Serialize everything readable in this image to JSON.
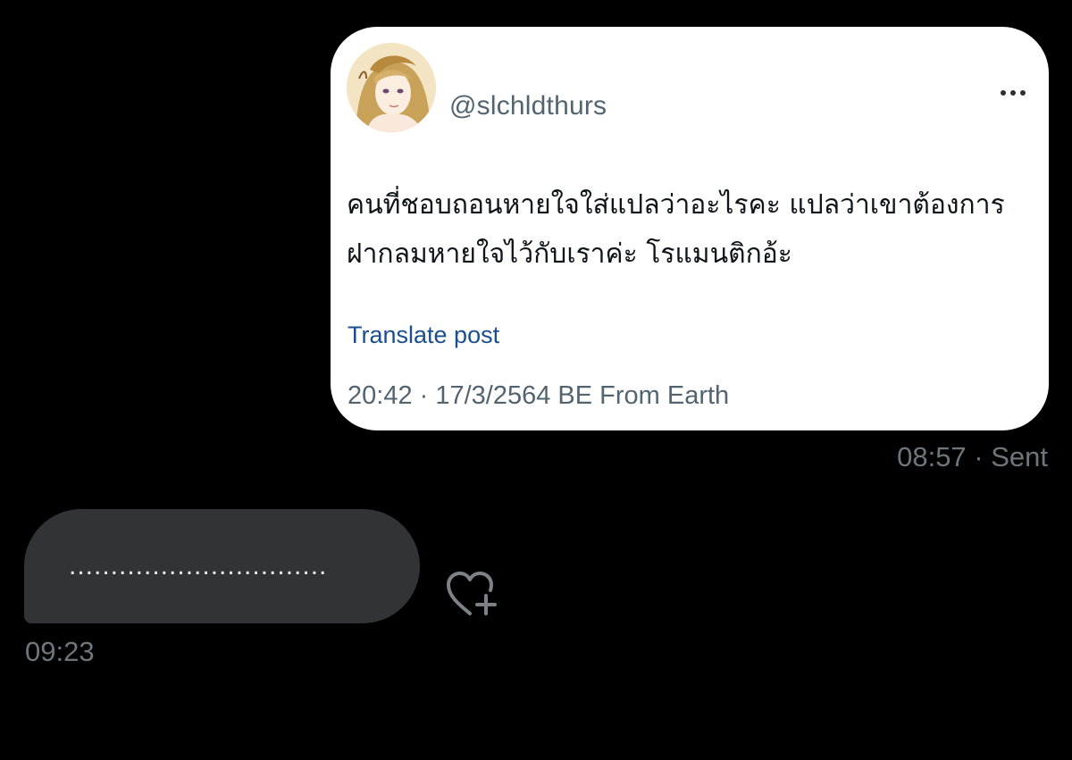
{
  "embedded_post": {
    "handle": "@slchldthurs",
    "text": "คนที่ชอบถอนหายใจใส่แปลว่าอะไรคะ แปลว่าเขาต้องการฝากลมหายใจไว้กับเราค่ะ โรแมนติกอ้ะ",
    "translate_label": "Translate post",
    "meta": "20:42 · 17/3/2564 BE From Earth",
    "avatar_icon": "profile-avatar",
    "more_icon": "more-options-icon"
  },
  "sent_message": {
    "status": "08:57 · Sent"
  },
  "received_message": {
    "text": "...............................",
    "time": "09:23",
    "reaction_icon": "add-reaction-heart-icon"
  },
  "colors": {
    "background": "#000000",
    "card_background": "#ffffff",
    "received_bubble": "#323336",
    "link": "#1a4f8f",
    "muted_text": "#6e767d"
  }
}
